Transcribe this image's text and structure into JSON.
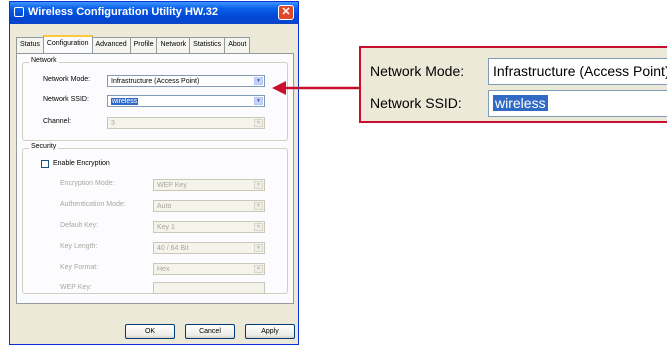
{
  "window": {
    "title": "Wireless Configuration Utility HW.32",
    "close_label": "✕"
  },
  "tabs": [
    {
      "label": "Status"
    },
    {
      "label": "Configuration"
    },
    {
      "label": "Advanced"
    },
    {
      "label": "Profile"
    },
    {
      "label": "Network"
    },
    {
      "label": "Statistics"
    },
    {
      "label": "About"
    }
  ],
  "network_group": {
    "label": "Network",
    "mode_label": "Network Mode:",
    "mode_value": "Infrastructure (Access Point)",
    "ssid_label": "Network SSID:",
    "ssid_value": "wireless",
    "channel_label": "Channel:",
    "channel_value": "3"
  },
  "security_group": {
    "label": "Security",
    "enable_encryption_label": "Enable Encryption",
    "enable_encryption_checked": false,
    "encryption_mode_label": "Encryption Mode:",
    "encryption_mode_value": "WEP Key",
    "auth_mode_label": "Authentication Mode:",
    "auth_mode_value": "Auto",
    "default_key_label": "Default Key:",
    "default_key_value": "Key 1",
    "key_length_label": "Key Length:",
    "key_length_value": "40 / 64 Bit",
    "key_format_label": "Key Format:",
    "key_format_value": "Hex",
    "wep_key_label": "WEP Key:",
    "wep_key_value": ""
  },
  "buttons": {
    "ok": "OK",
    "cancel": "Cancel",
    "apply": "Apply"
  },
  "zoom_callout": {
    "mode_label": "Network Mode:",
    "mode_value": "Infrastructure (Access Point)",
    "ssid_label": "Network SSID:",
    "ssid_value": "wireless"
  },
  "colors": {
    "titlebar": "#0046d5",
    "dialog_bg": "#ece9d8",
    "callout_border": "#c8102e",
    "selection": "#316ac5"
  }
}
